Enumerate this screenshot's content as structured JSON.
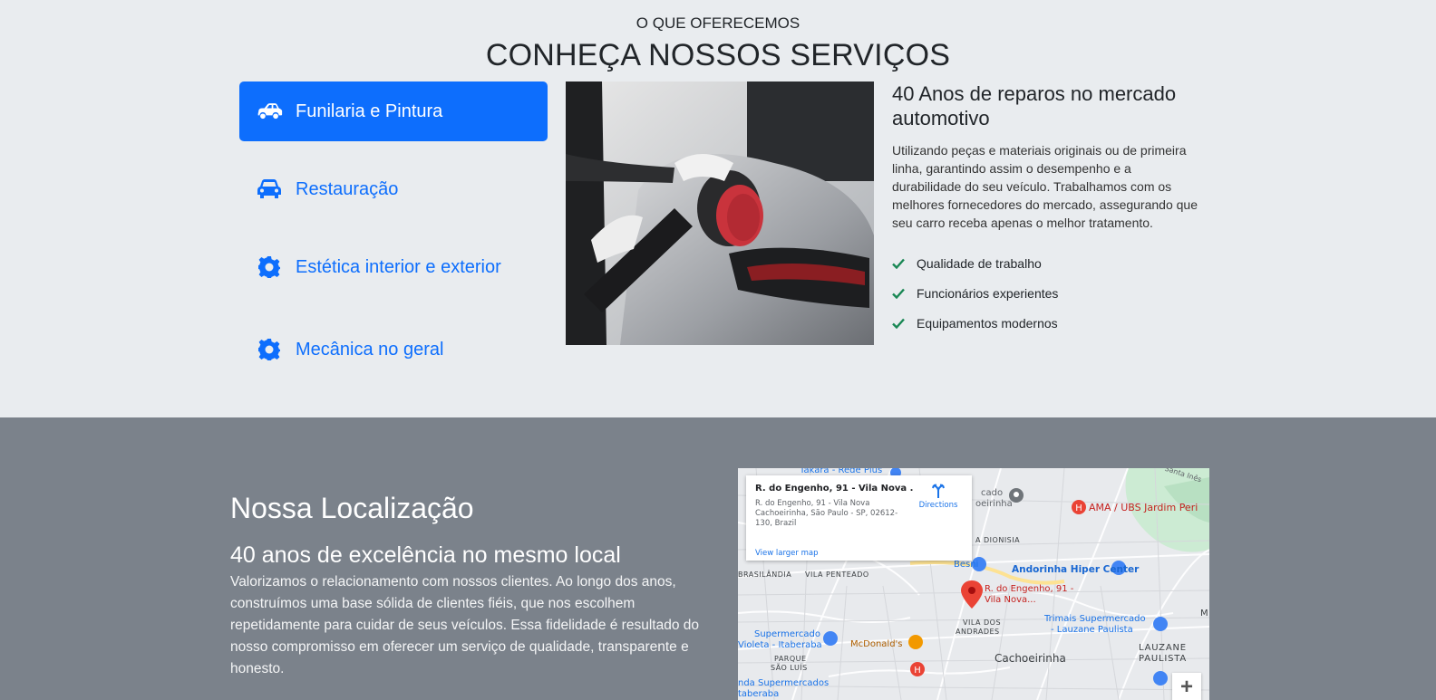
{
  "services": {
    "eyebrow": "O QUE OFERECEMOS",
    "title": "CONHEÇA NOSSOS SERVIÇOS",
    "tabs": [
      {
        "label": "Funilaria e Pintura",
        "icon": "car-side-icon",
        "active": true
      },
      {
        "label": "Restauração",
        "icon": "car-front-icon",
        "active": false
      },
      {
        "label": "Estética interior e exterior",
        "icon": "gear-icon",
        "active": false
      },
      {
        "label": "Mecânica no geral",
        "icon": "gear-icon",
        "active": false
      }
    ],
    "detail": {
      "heading": "40 Anos de reparos no mercado automotivo",
      "body": "Utilizando peças e materiais originais ou de primeira linha, garantindo assim o desempenho e a durabilidade do seu veículo. Trabalhamos com os melhores fornecedores do mercado, assegurando que seu carro receba apenas o melhor tratamento.",
      "checks": [
        "Qualidade de trabalho",
        "Funcionários experientes",
        "Equipamentos modernos"
      ]
    }
  },
  "location": {
    "title": "Nossa Localização",
    "subtitle": "40 anos de excelência no mesmo local",
    "body": "Valorizamos o relacionamento com nossos clientes. Ao longo dos anos, construímos uma base sólida de clientes fiéis, que nos escolhem repetidamente para cuidar de seus veículos. Essa fidelidade é resultado do nosso compromisso em oferecer um serviço de qualidade, transparente e honesto."
  },
  "map": {
    "card_title": "R. do Engenho, 91 - Vila Nova ...",
    "card_address": "R. do Engenho, 91 - Vila Nova Cachoeirinha, São Paulo - SP, 02612-130, Brazil",
    "directions": "Directions",
    "view_larger": "View larger map",
    "zoom_in": "+",
    "labels": {
      "takara": "Takara - Rede Plus",
      "santa_ines": "Santa Inês",
      "cado": "cado",
      "oeirinha": "oeirinha",
      "ama": "AMA / UBS Jardim Peri",
      "dionisia": "A DIONISIA",
      "besni": "Besni",
      "andorinha": "Andorinha Hiper Center",
      "brasilandia": "BRASILÂNDIA",
      "vila_penteado": "VILA PENTEADO",
      "pin_line1": "R. do Engenho, 91 -",
      "pin_line2": "Vila Nova...",
      "vila_dos": "VILA DOS",
      "andrades": "ANDRADES",
      "trimais1": "Trimais Supermercado",
      "trimais2": "- Lauzane Paulista",
      "supermercado": "Supermercado",
      "violeta": "Violeta - Itaberaba",
      "mcdonalds": "McDonald's",
      "cachoeirinha": "Cachoeirinha",
      "lauzane": "LAUZANE",
      "paulista": "PAULISTA",
      "parque": "PARQUE",
      "sao_luis": "SÃO LUÍS",
      "nda": "nda Supermercados",
      "itaberaba": "taberaba",
      "m": "M"
    }
  },
  "colors": {
    "primary": "#0d6efd",
    "check": "#198754",
    "band": "#7b828b",
    "pin": "#ea4335"
  }
}
